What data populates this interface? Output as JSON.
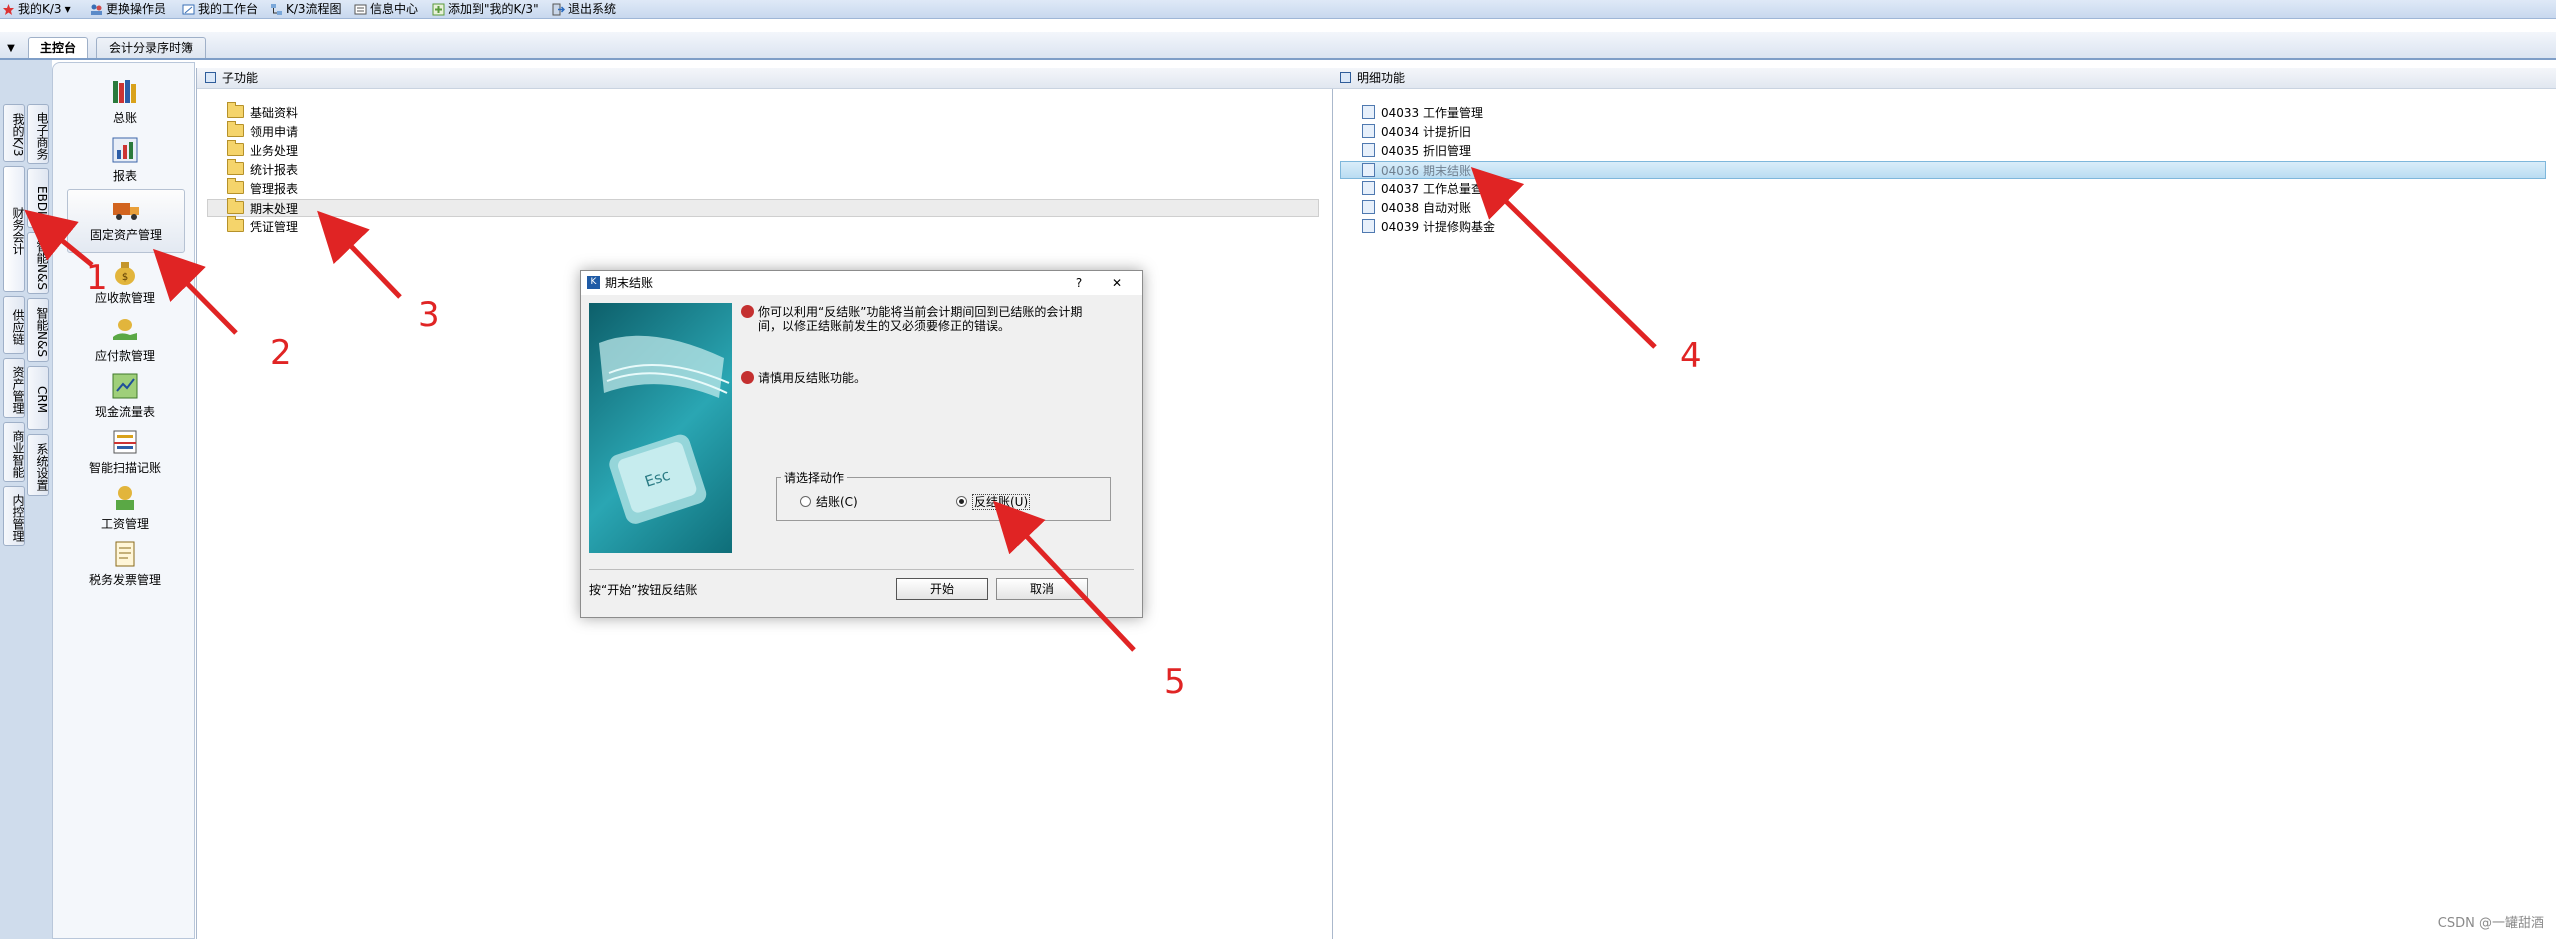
{
  "menubar": {
    "items": [
      "我的K/3",
      "更换操作员",
      "我的工作台",
      "K/3流程图",
      "信息中心",
      "添加到\"我的K/3\"",
      "退出系统"
    ]
  },
  "tabs": [
    "主控台",
    "会计分录序时簿"
  ],
  "left_vtabs": [
    "我的K/3",
    "财务会计",
    "供应链",
    "资产管理",
    "商业智能",
    "内控管理"
  ],
  "left_vtabs2": [
    "电子商务",
    "EBDI",
    "智能N&S",
    "智能N&S",
    "CRM",
    "系统设置"
  ],
  "modules": [
    "总账",
    "报表",
    "固定资产管理",
    "应收款管理",
    "应付款管理",
    "现金流量表",
    "智能扫描记账",
    "工资管理",
    "税务发票管理"
  ],
  "sub_panel": {
    "title": "子功能",
    "items": [
      "基础资料",
      "领用申请",
      "业务处理",
      "统计报表",
      "管理报表",
      "期末处理",
      "凭证管理"
    ]
  },
  "detail_panel": {
    "title": "明细功能",
    "items": [
      {
        "code": "04033",
        "label": "工作量管理"
      },
      {
        "code": "04034",
        "label": "计提折旧"
      },
      {
        "code": "04035",
        "label": "折旧管理"
      },
      {
        "code": "04036",
        "label": "期末结账"
      },
      {
        "code": "04037",
        "label": "工作总量查询"
      },
      {
        "code": "04038",
        "label": "自动对账"
      },
      {
        "code": "04039",
        "label": "计提修购基金"
      }
    ]
  },
  "dialog": {
    "title": "期末结账",
    "help": "?",
    "close": "✕",
    "info1_line1": "你可以利用“反结账”功能将当前会计期间回到已结账的会计期",
    "info1_line2": "间，以修正结账前发生的又必须要修正的错误。",
    "info2": "请慎用反结账功能。",
    "group_label": "请选择动作",
    "radio_close": "结账(C)",
    "radio_reverse": "反结账(U)",
    "status": "按“开始”按钮反结账",
    "start_button": "开始",
    "cancel_button": "取消",
    "image_key": "Esc"
  },
  "annotations": [
    "1",
    "2",
    "3",
    "4",
    "5"
  ],
  "watermark": "CSDN @一罐甜酒"
}
